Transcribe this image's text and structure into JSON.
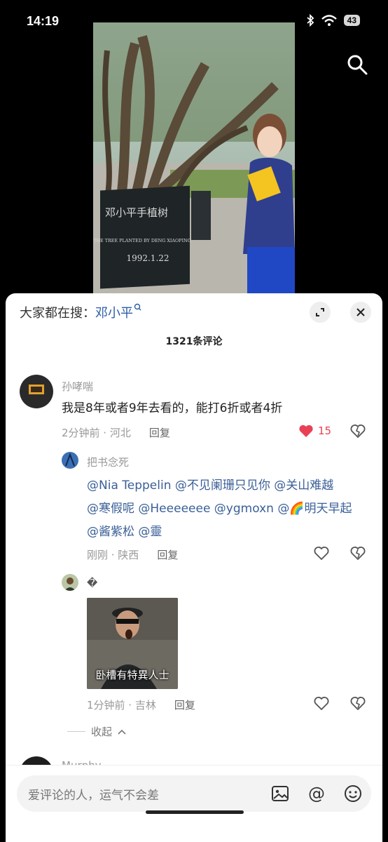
{
  "status": {
    "time": "14:19",
    "battery": "43"
  },
  "video": {
    "plaque_title": "邓小平手植树",
    "plaque_subtitle": "THE TREE PLANTED BY DENG XIAOPING",
    "plaque_date": "1992.1.22"
  },
  "sheet": {
    "search_prefix": "大家都在搜：",
    "search_keyword": "邓小平",
    "comment_count_title": "1321条评论"
  },
  "comments": [
    {
      "username": "孙哮喘",
      "text": "我是8年或者9年去看的，能打6折或者4折",
      "time_location": "2分钟前 · 河北",
      "reply_label": "回复",
      "likes": "15",
      "liked": true,
      "replies": [
        {
          "username": "把书念死",
          "line1": "@Nia Teppelin @不见阑珊只见你 @关山难越",
          "line2": "@寒假呢 @Heeeeeee @ygmoxn @🌈明天早起",
          "line3": "@酱紫松 @靈",
          "time_location": "刚刚 · 陕西",
          "reply_label": "回复"
        },
        {
          "username": "�",
          "gif_caption": "卧槽有特異人士",
          "time_location": "1分钟前 · 吉林",
          "reply_label": "回复"
        }
      ],
      "collapse_label": "收起"
    },
    {
      "username": "Murphy"
    }
  ],
  "input": {
    "placeholder": "爱评论的人，运气不会差"
  },
  "colors": {
    "like_red": "#e94154",
    "mention_blue": "#3a5f97",
    "keyword_blue": "#2c5da8"
  }
}
